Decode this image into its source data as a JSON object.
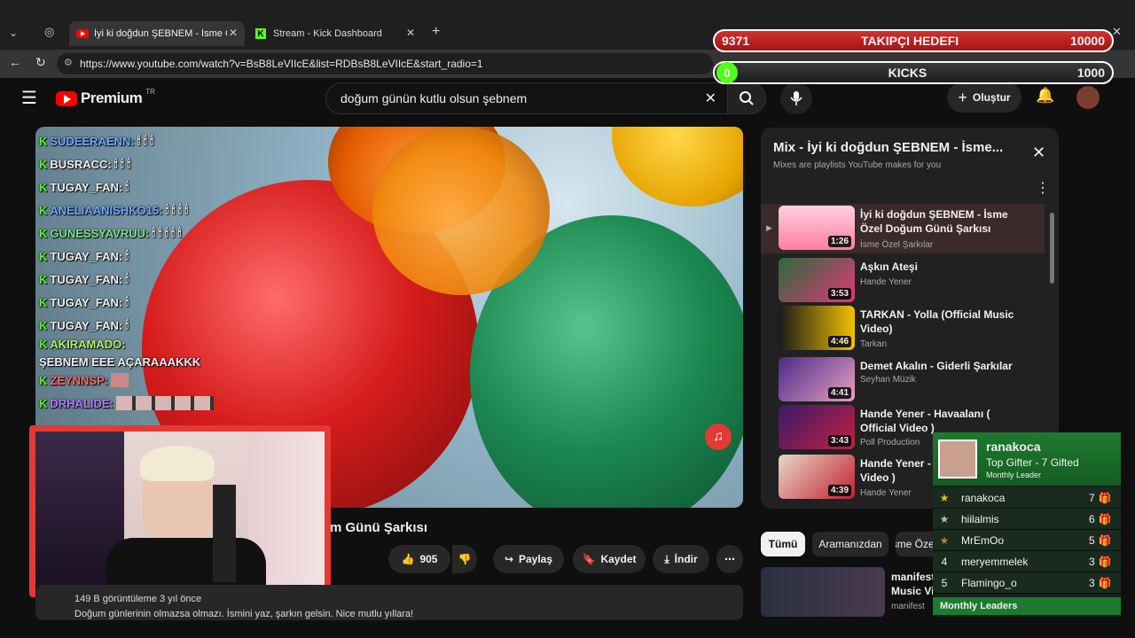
{
  "tabs": [
    {
      "label": "İyi ki doğdun ŞEBNEM - İsme Özel"
    },
    {
      "label": "Stream - Kick Dashboard"
    }
  ],
  "address": {
    "url": "https://www.youtube.com/watch?v=BsB8LeVIIcE&list=RDBsB8LeVIIcE&start_radio=1"
  },
  "youtube": {
    "logo_text": "Premium",
    "logo_region": "TR",
    "search_value": "doğum günün kutlu olsun şebnem",
    "create_label": "Oluştur"
  },
  "video": {
    "title_fragment": "m Günü Şarkısı",
    "likes": "905",
    "share_label": "Paylaş",
    "save_label": "Kaydet",
    "download_label": "İndir",
    "views_fragment": "149 B görüntüleme  3 yıl önce",
    "description": "Doğum günlerinin olmazsa olmazı. İsmini yaz, şarkın gelsin. Nice mutlu yıllara!"
  },
  "chat": [
    {
      "user": "SUDEERAENN:",
      "msg": "🕯 🕯 🕯",
      "color": "#6ea9ff"
    },
    {
      "user": "BUSRACC:",
      "msg": "🕯 🕯 🕯",
      "color": "#ffffff"
    },
    {
      "user": "TUGAY_FAN:",
      "msg": "🕯",
      "color": "#ffffff"
    },
    {
      "user": "ANELIAANISHKO15:",
      "msg": "🕯 🕯 🕯 🕯",
      "color": "#6ea9ff"
    },
    {
      "user": "GUNESSYAVRUU:",
      "msg": "🕯 🕯 🕯 🕯 🕯",
      "color": "#7ee08a"
    },
    {
      "user": "TUGAY_FAN:",
      "msg": "🕯",
      "color": "#ffffff"
    },
    {
      "user": "TUGAY_FAN:",
      "msg": "🕯",
      "color": "#ffffff"
    },
    {
      "user": "TUGAY_FAN:",
      "msg": "🕯",
      "color": "#ffffff"
    },
    {
      "user": "TUGAY_FAN:",
      "msg": "🕯",
      "color": "#ffffff"
    },
    {
      "user": "AKIRAMADO:",
      "msg": "ŞEBNEM EEE AÇARAAAKKK",
      "color": "#b5f06a"
    },
    {
      "user": "ZEYNNSP:",
      "msg": "",
      "color": "#ff6b6b"
    },
    {
      "user": "DRHALIDE:",
      "msg": "",
      "color": "#b57bff"
    }
  ],
  "goals": {
    "followers_current": "9371",
    "followers_label": "TAKIPÇI HEDEFI",
    "followers_target": "10000",
    "kicks_current": "0",
    "kicks_label": "KICKS",
    "kicks_target": "1000"
  },
  "mix": {
    "title": "Mix - İyi ki doğdun ŞEBNEM - İsme...",
    "subtitle": "Mixes are playlists YouTube makes for you",
    "items": [
      {
        "title": "İyi ki doğdun ŞEBNEM - İsme Özel Doğum Günü Şarkısı",
        "channel": "İsme Özel Şarkılar",
        "duration": "1:26"
      },
      {
        "title": "Aşkın Ateşi",
        "channel": "Hande Yener",
        "duration": "3:53"
      },
      {
        "title": "TARKAN - Yolla (Official Music Video)",
        "channel": "Tarkan",
        "duration": "4:46"
      },
      {
        "title": "Demet Akalın - Giderli Şarkılar",
        "channel": "Seyhan Müzik",
        "duration": "4:41"
      },
      {
        "title": "Hande Yener - Havaalanı ( Official Video )",
        "channel": "Poll Production",
        "duration": "3:43"
      },
      {
        "title": "Hande Yener - Aff (Official Video )",
        "channel": "Hande Yener",
        "duration": "4:39"
      }
    ]
  },
  "chips": {
    "all": "Tümü",
    "search": "Aramanızdan",
    "third": "İsme Özel Şarkılar tarafından y"
  },
  "related": {
    "title": "manifest - Amatör | Official Music Video",
    "channel": "manifest"
  },
  "leaderboard": {
    "top_user": "ranakoca",
    "top_title": "Top Gifter - 7 Gifted",
    "top_sub": "Monthly Leader",
    "rows": [
      {
        "rank": "★",
        "name": "ranakoca",
        "count": "7"
      },
      {
        "rank": "★",
        "name": "hiilalmis",
        "count": "6"
      },
      {
        "rank": "★",
        "name": "MrEmOo",
        "count": "5"
      },
      {
        "rank": "4",
        "name": "meryemmelek",
        "count": "3"
      },
      {
        "rank": "5",
        "name": "Flamingo_o",
        "count": "3"
      }
    ],
    "footer": "Monthly Leaders"
  }
}
